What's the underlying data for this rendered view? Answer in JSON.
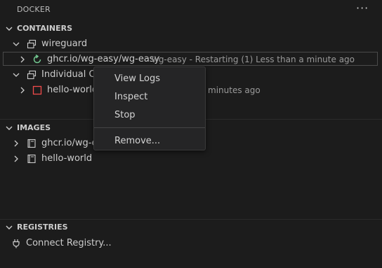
{
  "panel": {
    "title": "DOCKER",
    "more_label": "···"
  },
  "containers": {
    "header": "CONTAINERS",
    "group_wireguard": "wireguard",
    "wg_image": "ghcr.io/wg-easy/wg-easy",
    "wg_desc": "wg-easy - Restarting (1) Less than a minute ago",
    "group_individual": "Individual Co",
    "hello_name": "hello-world",
    "hello_desc": "minutes ago"
  },
  "images": {
    "header": "IMAGES",
    "item_1": "ghcr.io/wg-e",
    "item_2": "hello-world"
  },
  "registries": {
    "header": "REGISTRIES",
    "connect": "Connect Registry..."
  },
  "context_menu": {
    "view_logs": "View Logs",
    "inspect": "Inspect",
    "stop": "Stop",
    "remove": "Remove..."
  },
  "colors": {
    "restart_icon": "#73c991",
    "stopped_icon": "#f14c4c",
    "accent_bg": "#1c1c1c"
  },
  "icons": {
    "group": "window-group-icon",
    "restart": "restart-icon",
    "stopped": "stopped-container-icon",
    "image": "image-icon",
    "plug": "plug-icon",
    "more": "more-actions-icon"
  }
}
